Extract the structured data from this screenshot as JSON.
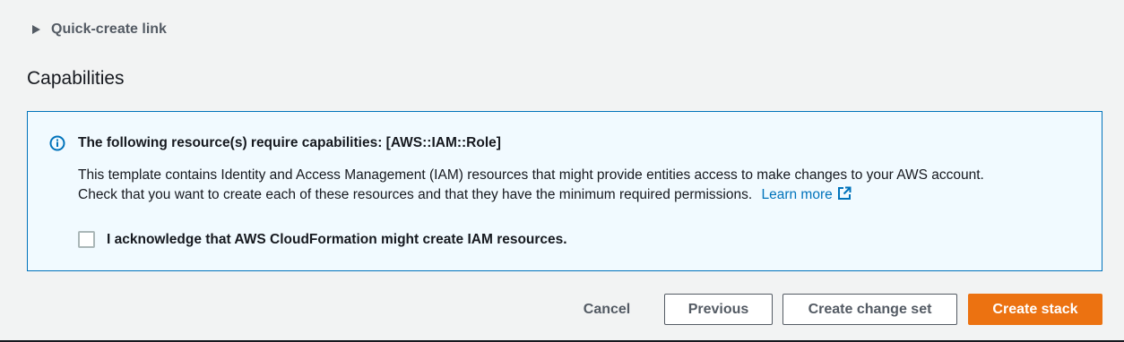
{
  "quick_create": {
    "label": "Quick-create link",
    "icon": "caret-right-icon"
  },
  "capabilities": {
    "title": "Capabilities",
    "alert": {
      "icon": "info-icon",
      "heading": "The following resource(s) require capabilities: [AWS::IAM::Role]",
      "body_line1": "This template contains Identity and Access Management (IAM) resources that might provide entities access to make changes to your AWS account.",
      "body_line2": "Check that you want to create each of these resources and that they have the minimum required permissions.",
      "learn_more": "Learn more",
      "learn_more_icon": "external-link-icon",
      "acknowledge_label": "I acknowledge that AWS CloudFormation might create IAM resources.",
      "acknowledge_checked": false
    }
  },
  "actions": {
    "cancel": "Cancel",
    "previous": "Previous",
    "create_change_set": "Create change set",
    "create_stack": "Create stack"
  },
  "colors": {
    "primary": "#ec7211",
    "info_border": "#0073bb",
    "info_bg": "#f1faff",
    "link": "#0073bb"
  }
}
